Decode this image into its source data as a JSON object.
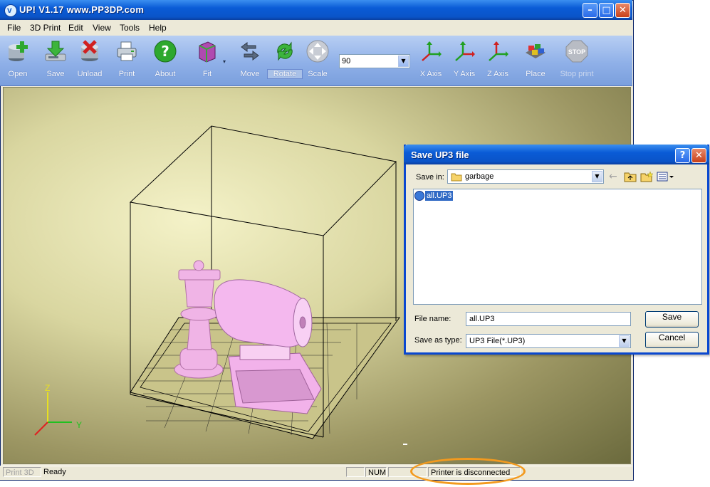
{
  "window": {
    "title": "UP!  V1.17  www.PP3DP.com"
  },
  "menu": [
    "File",
    "3D Print",
    "Edit",
    "View",
    "Tools",
    "Help"
  ],
  "toolbar": {
    "open": "Open",
    "save": "Save",
    "unload": "Unload",
    "print": "Print",
    "about": "About",
    "fit": "Fit",
    "move": "Move",
    "rotate": "Rotate",
    "scale": "Scale",
    "scale_value": "90",
    "x_axis": "X Axis",
    "y_axis": "Y Axis",
    "z_axis": "Z Axis",
    "place": "Place",
    "stop_print": "Stop print",
    "stop_sign": "STOP"
  },
  "viewport": {
    "axis_z": "Z",
    "axis_y": "Y"
  },
  "statusbar": {
    "mode": "Print 3D",
    "ready": "Ready",
    "num": "NUM",
    "printer": "Printer is disconnected"
  },
  "dialog": {
    "title": "Save UP3 file",
    "save_in_label": "Save in:",
    "folder": "garbage",
    "files": [
      "all.UP3"
    ],
    "file_name_label": "File name:",
    "file_name_value": "all.UP3",
    "save_as_label": "Save as type:",
    "save_as_value": "UP3 File(*.UP3)",
    "save_button": "Save",
    "cancel_button": "Cancel"
  }
}
